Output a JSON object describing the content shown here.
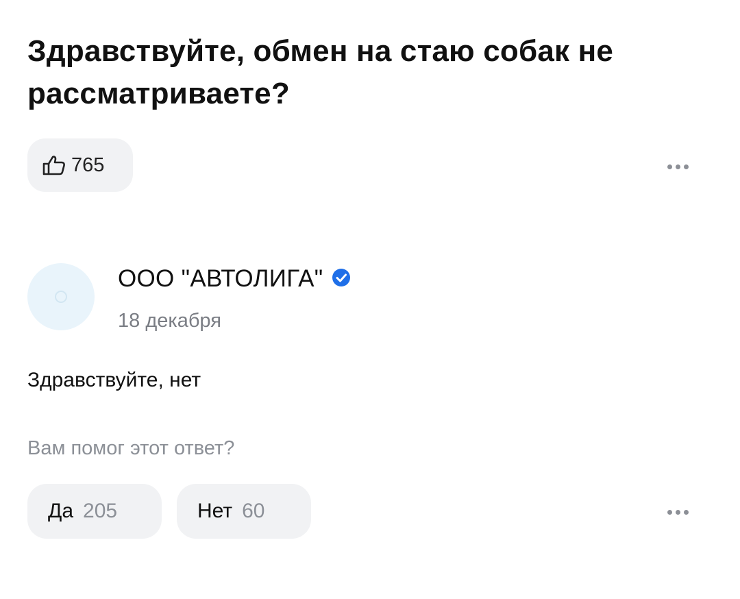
{
  "question": {
    "title": "Здравствуйте, обмен на стаю собак не рассматриваете?",
    "likes": "765"
  },
  "answer": {
    "author": "ООО \"АВТОЛИГА\"",
    "verified": true,
    "date": "18 декабря",
    "text": "Здравствуйте, нет"
  },
  "feedback": {
    "question": "Вам помог этот ответ?",
    "yes_label": "Да",
    "yes_count": "205",
    "no_label": "Нет",
    "no_count": "60"
  },
  "icons": {
    "like": "thumbs-up-icon",
    "more": "more-dots-icon",
    "verified": "verified-check-icon"
  },
  "colors": {
    "verified": "#1f6fe8",
    "pill_bg": "#f1f2f4",
    "muted_text": "#8c9097",
    "avatar_bg": "#e9f4fb"
  }
}
